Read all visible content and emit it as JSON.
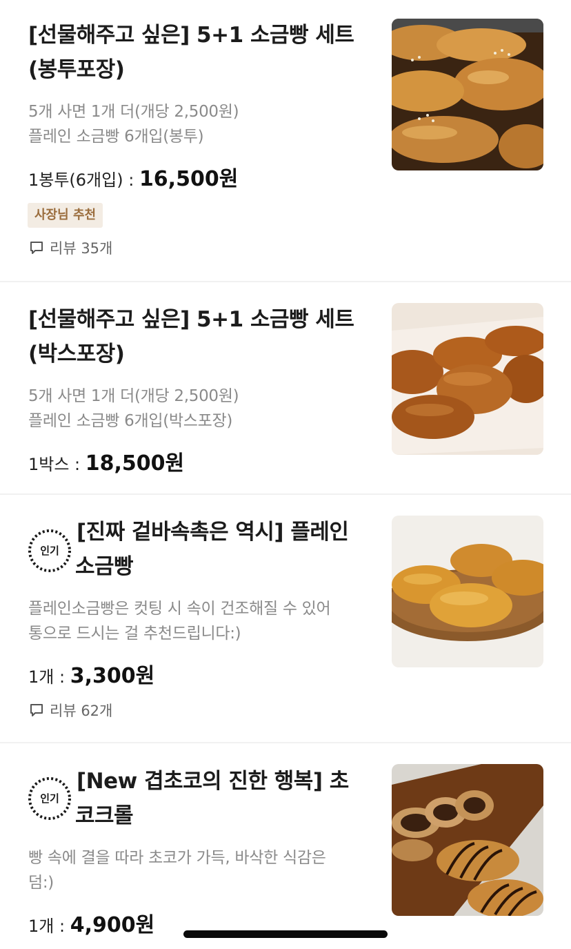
{
  "products": [
    {
      "title_lines": [
        "[선물해주고 싶은] 5+1 소금빵 세트",
        "(봉투포장)"
      ],
      "desc_lines": [
        "5개 사면 1개 더(개당 2,500원)",
        "플레인 소금빵 6개입(봉투)"
      ],
      "price_label": "1봉투(6개입) : ",
      "price": "16,500원",
      "badge": "사장님 추천",
      "review": "리뷰 35개",
      "image_icon": "salt-bread-bag-photo"
    },
    {
      "title_lines": [
        "[선물해주고 싶은] 5+1 소금빵 세트",
        "(박스포장)"
      ],
      "desc_lines": [
        "5개 사면 1개 더(개당 2,500원)",
        "플레인 소금빵 6개입(박스포장)"
      ],
      "price_label": "1박스 : ",
      "price": "18,500원",
      "image_icon": "salt-bread-box-photo"
    },
    {
      "popular_badge": "인기",
      "title_lines": [
        "[진짜 겉바속촉은 역시] 플레인",
        "소금빵"
      ],
      "desc_lines": [
        "플레인소금빵은 컷팅 시 속이 건조해질 수 있어",
        "통으로 드시는 걸 추천드립니다:)"
      ],
      "price_label": "1개 : ",
      "price": "3,300원",
      "review": "리뷰 62개",
      "image_icon": "plain-salt-bread-tray-photo"
    },
    {
      "popular_badge": "인기",
      "title_lines": [
        "[New 겹초코의 진한 행복] 초",
        "코크롤"
      ],
      "desc_lines": [
        "빵 속에 결을 따라 초코가 가득, 바삭한 식감은",
        "덤:)"
      ],
      "price_label": "1개 : ",
      "price": "4,900원",
      "image_icon": "choco-roll-photo"
    }
  ],
  "colors": {
    "badge_bg": "#f3ece3",
    "badge_text": "#9a6c3c",
    "desc_text": "#8a8a8a",
    "divider": "#f1f1f1"
  }
}
